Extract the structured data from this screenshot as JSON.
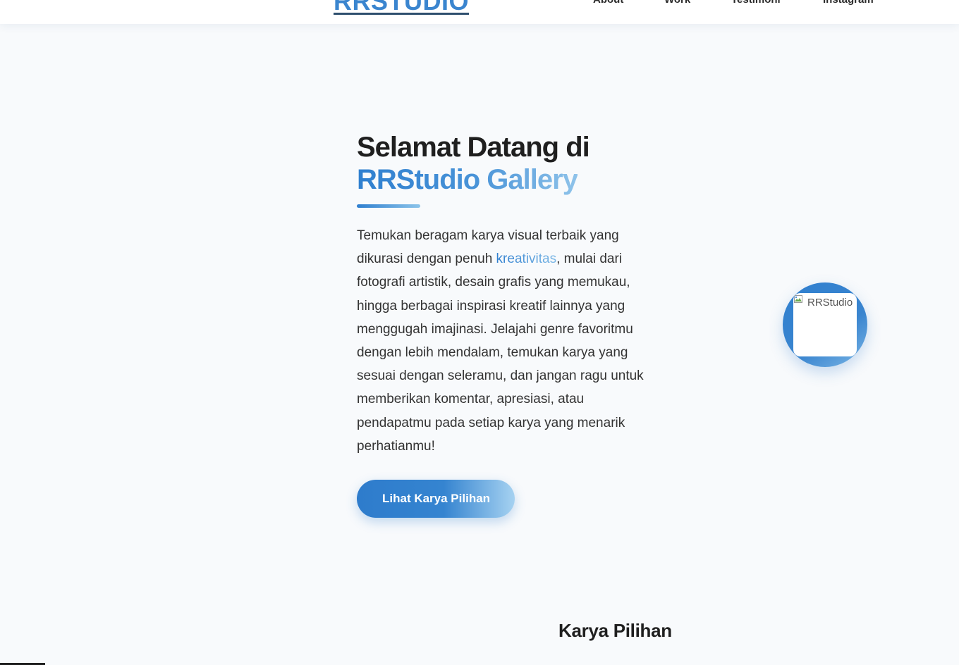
{
  "navbar": {
    "brand": "RRSTUDIO",
    "items": [
      {
        "label": "About"
      },
      {
        "label": "Work"
      },
      {
        "label": "Testimoni"
      },
      {
        "label": "Instagram"
      }
    ]
  },
  "hero": {
    "title_line1": "Selamat Datang di",
    "title_line2": "RRStudio Gallery",
    "desc_before": "Temukan beragam karya visual terbaik yang dikurasi dengan penuh ",
    "desc_highlight": "kreativitas",
    "desc_after": ", mulai dari fotografi artistik, desain grafis yang memukau, hingga berbagai inspirasi kreatif lainnya yang menggugah imajinasi. Jelajahi genre favoritmu dengan lebih mendalam, temukan karya yang sesuai dengan seleramu, dan jangan ragu untuk memberikan komentar, apresiasi, atau pendapatmu pada setiap karya yang menarik perhatianmu!",
    "cta_label": "Lihat Karya Pilihan"
  },
  "avatar": {
    "alt": "RRStudio",
    "icon": "broken-image-icon"
  },
  "section": {
    "title": "Karya Pilihan"
  },
  "colors": {
    "accent": "#3a85cf",
    "accent_light": "#8fc3ea",
    "background": "#f8fafc",
    "text": "#2b2b2b"
  }
}
